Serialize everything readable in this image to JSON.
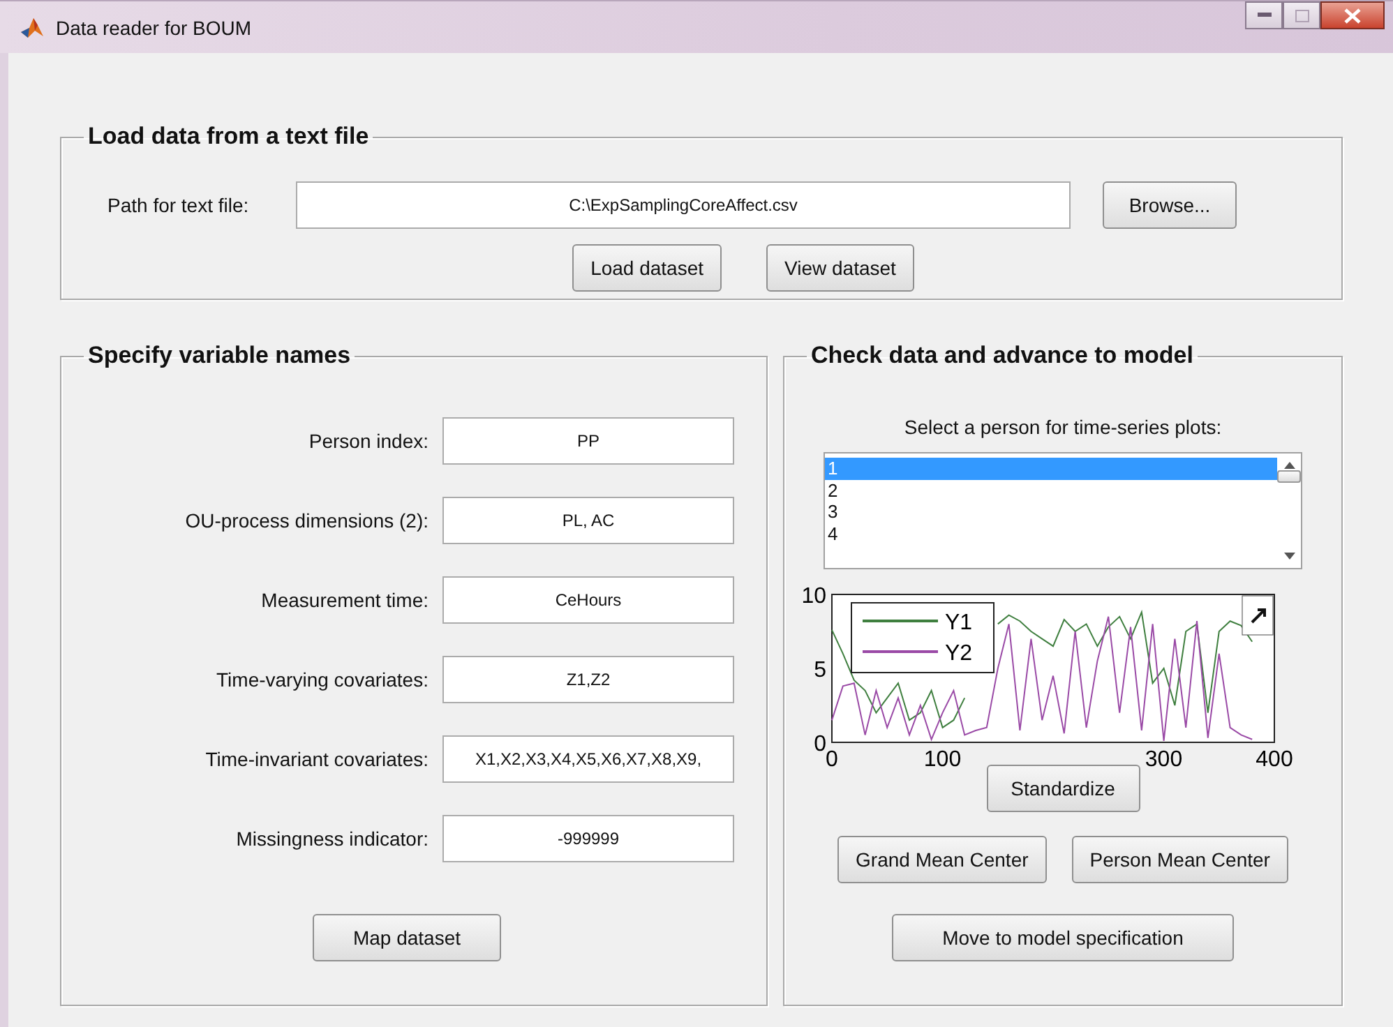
{
  "window": {
    "title": "Data reader for BOUM"
  },
  "load_group": {
    "title": "Load data from a text file",
    "path_label": "Path for text file:",
    "path_value": "C:\\ExpSamplingCoreAffect.csv",
    "browse_button": "Browse...",
    "buttons": [
      "Load dataset",
      "View dataset"
    ]
  },
  "variables_group": {
    "title": "Specify variable names",
    "fields": [
      {
        "label": "Person index:",
        "value": "PP"
      },
      {
        "label": "OU-process dimensions (2):",
        "value": "PL, AC"
      },
      {
        "label": "Measurement time:",
        "value": "CeHours"
      },
      {
        "label": "Time-varying covariates:",
        "value": "Z1,Z2"
      },
      {
        "label": "Time-invariant covariates:",
        "value": "X1,X2,X3,X4,X5,X6,X7,X8,X9,"
      },
      {
        "label": "Missingness indicator:",
        "value": "-999999"
      }
    ],
    "button": "Map dataset"
  },
  "check_group": {
    "title": "Check data and advance to model",
    "list_label": "Select a person for time-series plots:",
    "persons": [
      {
        "label": "1",
        "selected": true
      },
      {
        "label": "2",
        "selected": false
      },
      {
        "label": "3",
        "selected": false
      },
      {
        "label": "4",
        "selected": false
      }
    ],
    "plot": {
      "chart_data": {
        "type": "line",
        "x": [
          0,
          10,
          20,
          30,
          40,
          50,
          60,
          70,
          80,
          90,
          100,
          110,
          120,
          130,
          140,
          150,
          160,
          170,
          180,
          190,
          200,
          210,
          220,
          230,
          240,
          250,
          260,
          270,
          280,
          290,
          300,
          310,
          320,
          330,
          340,
          350,
          360,
          370,
          380
        ],
        "xlim": [
          0,
          400
        ],
        "ylim": [
          0,
          10
        ],
        "xticks": [
          0,
          100,
          300,
          400
        ],
        "yticks": [
          0,
          5,
          10
        ],
        "legend": "upper left",
        "series": [
          {
            "name": "Y1",
            "color": "#3f7f3f",
            "values": [
              7.6,
              6,
              4.2,
              3.5,
              2,
              3,
              4,
              1.5,
              2,
              3.5,
              1,
              1.5,
              3,
              null,
              null,
              8,
              8.6,
              8.2,
              7.5,
              7,
              6.5,
              8.3,
              7.5,
              8,
              6.5,
              7.8,
              8.5,
              7,
              8.8,
              4,
              5,
              2.5,
              7.5,
              8,
              2,
              7.5,
              8.2,
              7.9,
              6.8
            ]
          },
          {
            "name": "Y2",
            "color": "#9a4aa6",
            "values": [
              1.5,
              3.8,
              4,
              0.5,
              3.5,
              1,
              3,
              0.5,
              2.5,
              0.2,
              2,
              3.5,
              0.5,
              0.8,
              1,
              5,
              8,
              0.8,
              7,
              1.5,
              4.5,
              0.6,
              7.5,
              1,
              5.5,
              8.5,
              2,
              7.8,
              0.8,
              8,
              0.1,
              7,
              1,
              8.2,
              0.3,
              6,
              1,
              0.5,
              0.2
            ]
          }
        ]
      }
    },
    "standardize_button": "Standardize",
    "center_buttons": [
      "Grand Mean Center",
      "Person Mean Center"
    ],
    "advance_button": "Move to model specification"
  }
}
